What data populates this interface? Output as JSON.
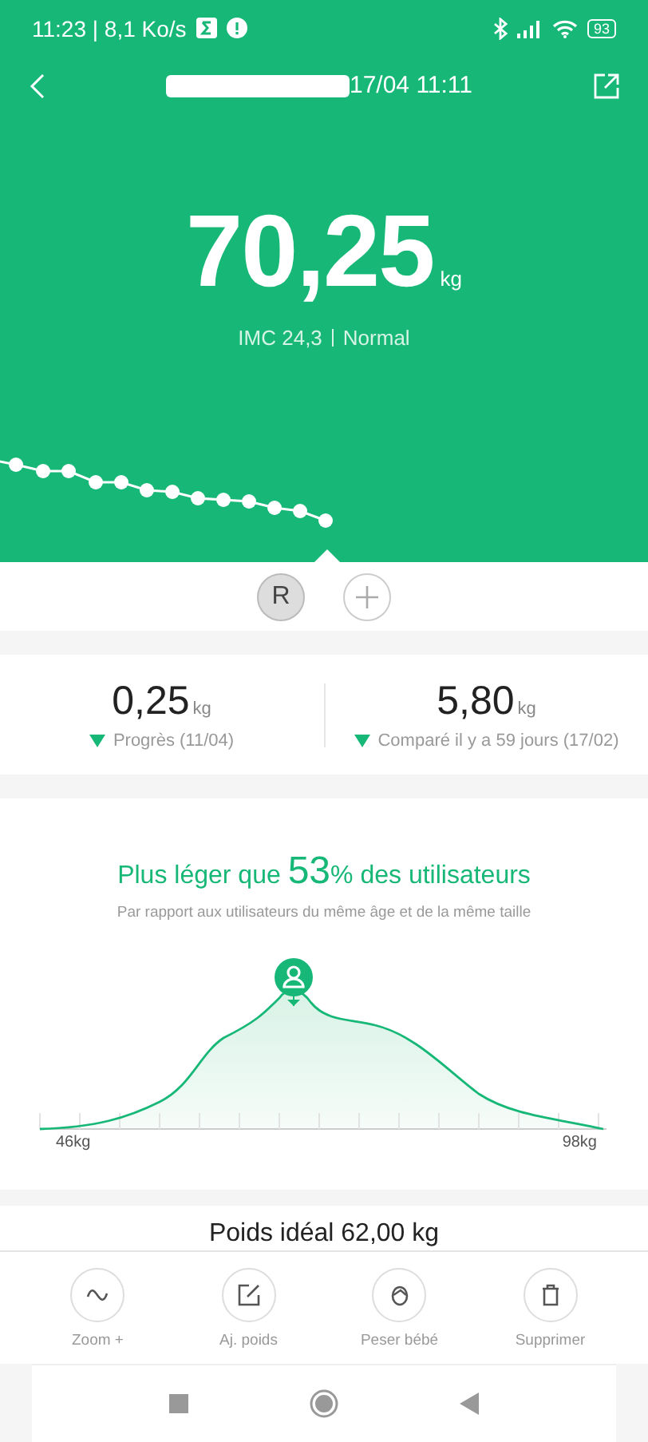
{
  "status_bar": {
    "time": "11:23 | 8,1 Ko/s",
    "battery": "93"
  },
  "header": {
    "title": "17/04 11:11",
    "weight": "70,25",
    "unit": "kg",
    "bmi": "IMC 24,3",
    "bmi_status": "Normal"
  },
  "profiles": [
    {
      "label": "R",
      "selected": true
    }
  ],
  "stats": [
    {
      "value": "0,25",
      "unit": "kg",
      "kind": "down",
      "label": "Progrès (11/04)"
    },
    {
      "value": "5,80",
      "unit": "kg",
      "kind": "down",
      "label": "Comparé il y a 59 jours (17/02)"
    }
  ],
  "comparison": {
    "prefix": "Plus léger que",
    "percent": "53",
    "suffix": "% des utilisateurs",
    "note": "Par rapport aux utilisateurs du même âge et de la même taille",
    "axis_min": "46kg",
    "axis_max": "98kg"
  },
  "ideal": {
    "text": "Poids idéal 62,00 kg"
  },
  "actions": [
    {
      "kind": "zoom",
      "label": "Zoom +"
    },
    {
      "kind": "edit",
      "label": "Aj. poids"
    },
    {
      "kind": "baby",
      "label": "Peser bébé"
    },
    {
      "kind": "delete",
      "label": "Supprimer"
    }
  ]
}
